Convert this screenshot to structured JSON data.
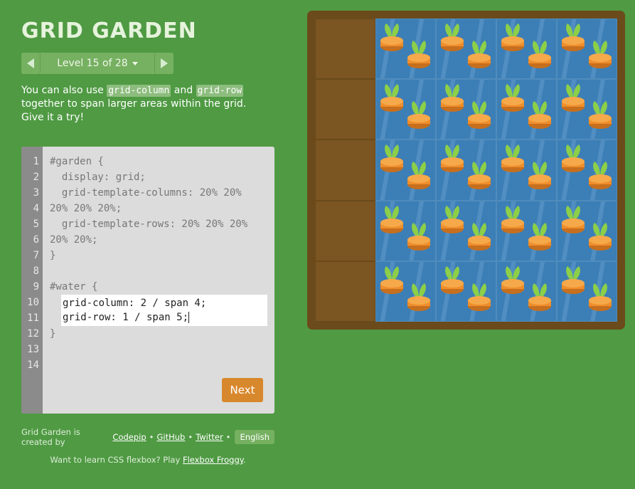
{
  "app": {
    "title": "GRID GARDEN"
  },
  "level_nav": {
    "label": "Level 15 of 28",
    "prev_icon": "triangle-left-icon",
    "next_icon": "triangle-right-icon",
    "dropdown_icon": "caret-down-icon"
  },
  "instructions": {
    "prefix": "You can also use ",
    "code1": "grid-column",
    "mid": " and ",
    "code2": "grid-row",
    "suffix": " together to span larger areas within the grid. Give it a try!"
  },
  "editor": {
    "line_numbers": [
      "1",
      "2",
      "3",
      "4",
      "5",
      "6",
      "7",
      "8",
      "9",
      "10",
      "11",
      "12",
      "13",
      "14"
    ],
    "pre_lines": [
      "#garden {",
      "  display: grid;",
      "  grid-template-columns: 20% 20%",
      "20% 20% 20%;",
      "  grid-template-rows: 20% 20% 20%",
      "20% 20%;",
      "}",
      "",
      "#water {"
    ],
    "input_lines": [
      "grid-column: 2 / span 4;",
      "grid-row: 1 / span 5;"
    ],
    "post_lines": [
      "}"
    ],
    "next_label": "Next"
  },
  "footer": {
    "created_by": "Grid Garden is created by",
    "codepip": "Codepip",
    "sep": "•",
    "github": "GitHub",
    "twitter": "Twitter",
    "language": "English",
    "flexbox_prefix": "Want to learn CSS flexbox? Play",
    "flexbox_link": "Flexbox Froggy",
    "flexbox_suffix": "."
  },
  "garden": {
    "columns": 5,
    "rows": 5,
    "water_column_start": 2,
    "water_column_span": 4,
    "water_row_start": 1,
    "water_row_span": 5,
    "colors": {
      "water": "#3c7fb6",
      "dirt": "#7b5522",
      "frame": "#6b4a1b",
      "carrot": "#ef8e2c",
      "leaf": "#8ccf48",
      "background": "#4f9a43",
      "next_button": "#d8882c"
    }
  }
}
